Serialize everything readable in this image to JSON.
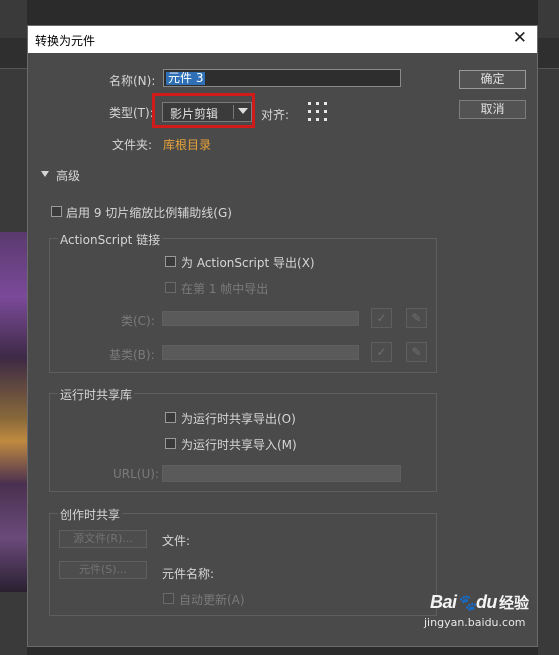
{
  "dialog": {
    "title": "转换为元件",
    "close_glyph": "✕"
  },
  "form": {
    "name_label": "名称(N):",
    "name_value": "元件 3",
    "type_label": "类型(T):",
    "type_value": "影片剪辑",
    "align_label": "对齐:",
    "folder_label": "文件夹:",
    "folder_value": "库根目录"
  },
  "buttons": {
    "ok": "确定",
    "cancel": "取消"
  },
  "advanced": {
    "label": "高级",
    "nine_slice_label": "启用 9 切片缩放比例辅助线(G)"
  },
  "actionscript": {
    "title": "ActionScript 链接",
    "export_label": "为 ActionScript 导出(X)",
    "export_frame1_label": "在第 1 帧中导出",
    "class_label": "类(C):",
    "base_class_label": "基类(B):"
  },
  "runtime_sharing": {
    "title": "运行时共享库",
    "export_label": "为运行时共享导出(O)",
    "import_label": "为运行时共享导入(M)",
    "url_label": "URL(U):"
  },
  "authoring_sharing": {
    "title": "创作时共享",
    "source_file_button": "源文件(R)...",
    "symbol_button": "元件(S)...",
    "file_label": "文件:",
    "symbol_name_label": "元件名称:",
    "auto_update_label": "自动更新(A)"
  },
  "watermark": {
    "logo": "Bai",
    "logo_du": "du",
    "experience": "经验",
    "url": "jingyan.baidu.com"
  },
  "colors": {
    "accent_folder": "#e8a33a",
    "highlight_box": "#d11a1a",
    "selection": "#2f6fb6"
  }
}
